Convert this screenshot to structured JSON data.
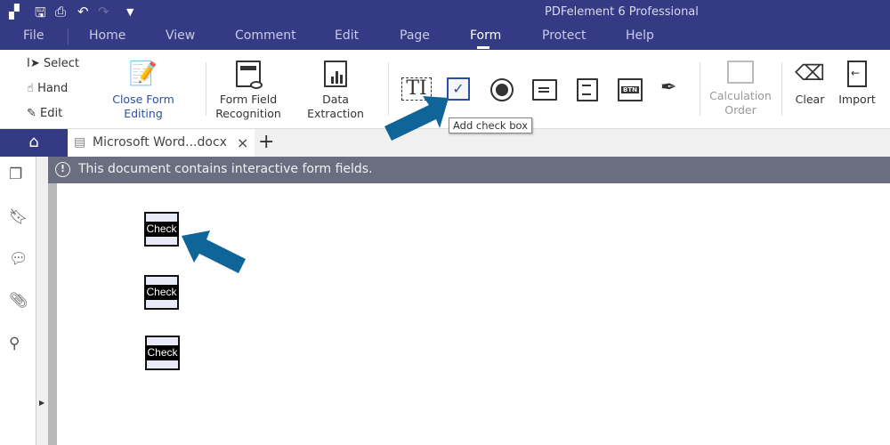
{
  "app_title": "PDFelement 6 Professional",
  "menu": [
    "File",
    "Home",
    "View",
    "Comment",
    "Edit",
    "Page",
    "Form",
    "Protect",
    "Help"
  ],
  "ribbon": {
    "select": "Select",
    "hand": "Hand",
    "edit": "Edit",
    "close_form_editing": "Close Form Editing",
    "form_field_recognition": [
      "Form Field",
      "Recognition"
    ],
    "data_extraction": "Data Extraction",
    "calculation_order": [
      "Calculation",
      "Order"
    ],
    "clear": "Clear",
    "import": "Import",
    "btn_text": "BTN"
  },
  "tooltip": "Add check box",
  "tab": {
    "title": "Microsoft Word...docx",
    "close": "×",
    "new": "+"
  },
  "notice": "This document contains interactive form fields.",
  "checkboxes": [
    "Check",
    "Check",
    "Check"
  ],
  "colors": {
    "navy": "#343a84",
    "arrow": "#0f6597",
    "accent": "#2b4fa0"
  }
}
